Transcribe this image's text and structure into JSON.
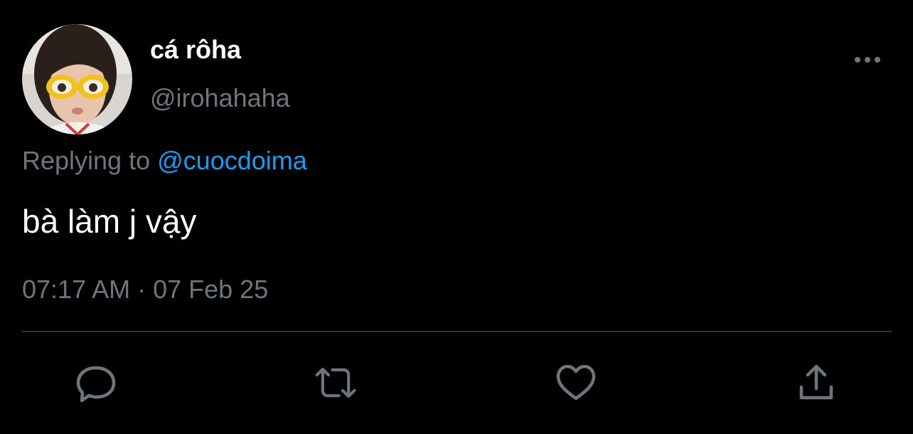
{
  "tweet": {
    "author": {
      "display_name": "cá rôha",
      "handle": "@irohahaha"
    },
    "replying_to_prefix": "Replying to",
    "replying_to_handle": "@cuocdoima",
    "text": "bà làm j vậy",
    "timestamp": "07:17 AM · 07 Feb 25"
  },
  "actions": {
    "reply_icon": "comment-icon",
    "retweet_icon": "retweet-icon",
    "like_icon": "heart-icon",
    "share_icon": "share-icon",
    "more_icon": "more-horizontal-icon"
  },
  "colors": {
    "background": "#000000",
    "primary_text": "#ffffff",
    "secondary_text": "#6e767d",
    "link": "#1d9bf0",
    "divider": "#2f3336",
    "icon": "#6e767d"
  }
}
